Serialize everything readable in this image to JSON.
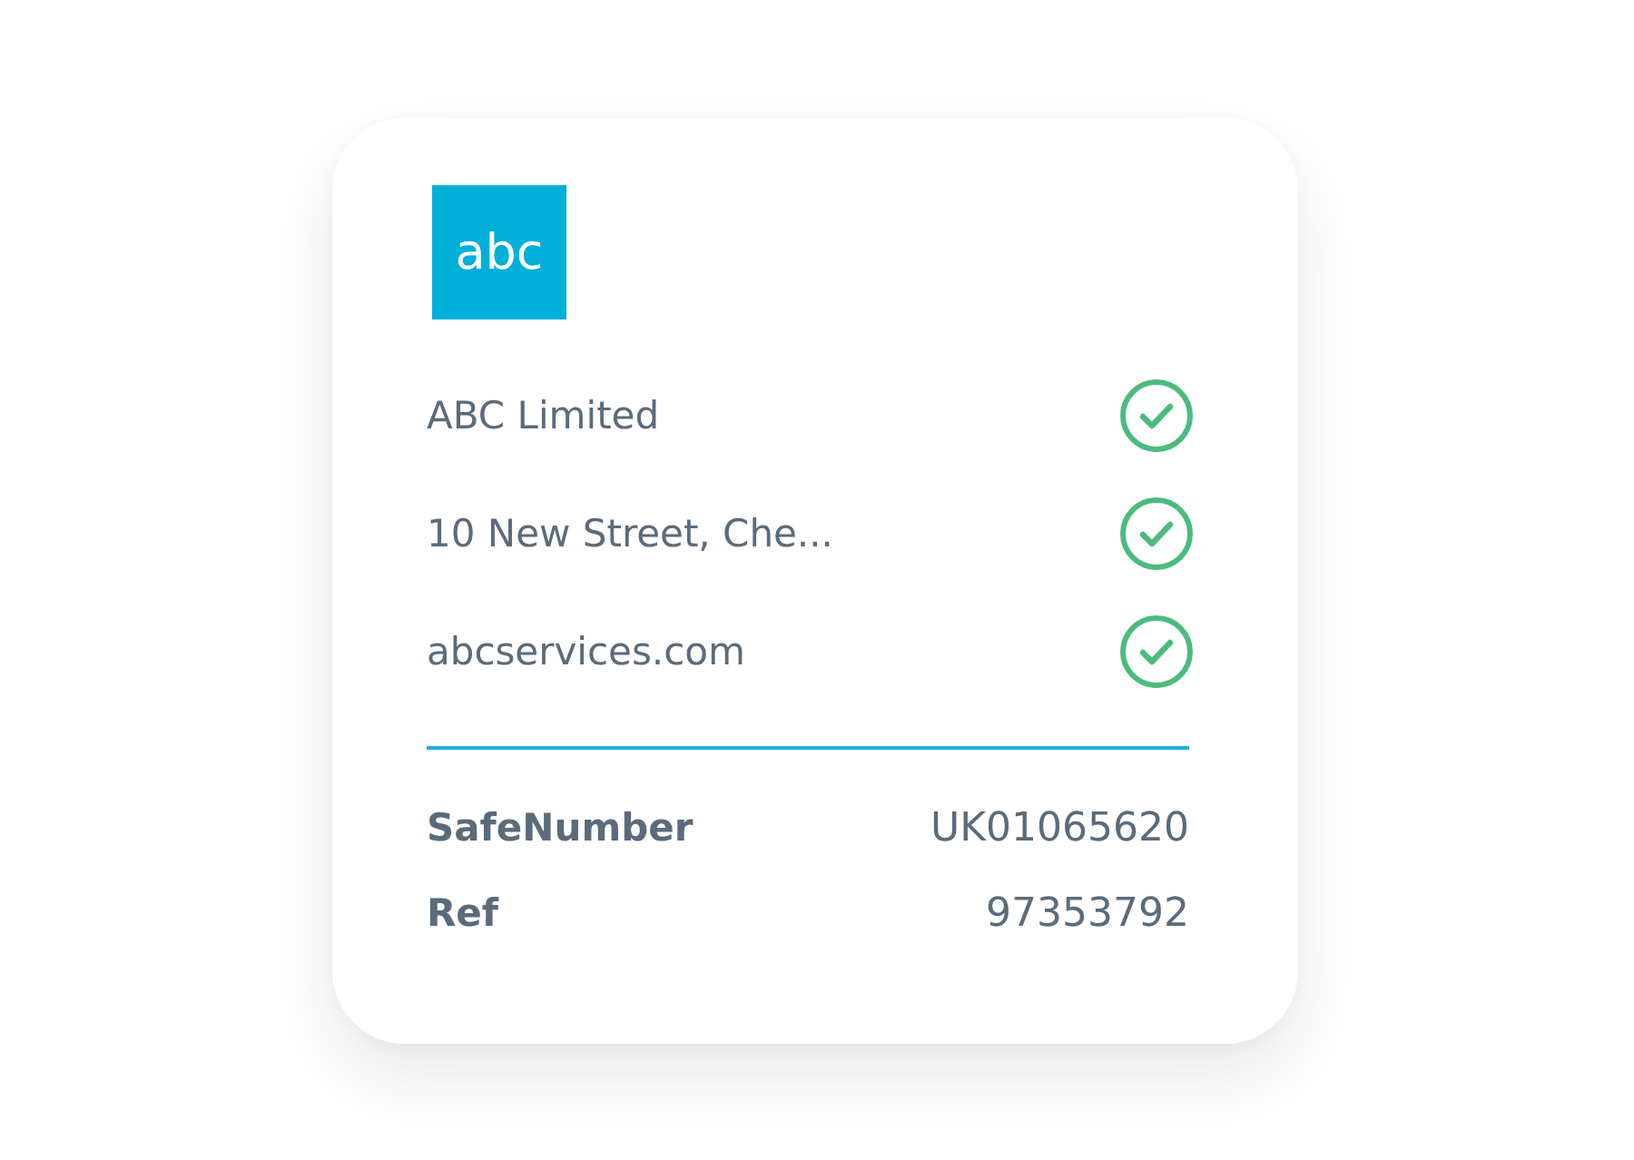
{
  "logo": {
    "text": "abc"
  },
  "details": [
    {
      "text": "ABC Limited",
      "verified": true
    },
    {
      "text": "10 New Street, Che...",
      "verified": true
    },
    {
      "text": "abcservices.com",
      "verified": true
    }
  ],
  "identifiers": [
    {
      "label": "SafeNumber",
      "value": "UK01065620"
    },
    {
      "label": "Ref",
      "value": "97353792"
    }
  ]
}
